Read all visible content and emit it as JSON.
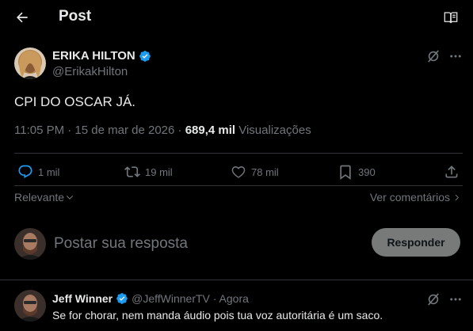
{
  "header": {
    "title": "Post"
  },
  "post": {
    "author_name": "ERIKA HILTON",
    "author_handle": "@ErikakHilton",
    "text": "CPI DO OSCAR JÁ.",
    "timestamp": "11:05 PM · 15 de mar de 2026 · ",
    "views_count": "689,4 mil",
    "views_label": " Visualizações",
    "actions": {
      "replies": "1 mil",
      "reposts": "19 mil",
      "likes": "78 mil",
      "bookmarks": "390"
    }
  },
  "sort": {
    "label": "Relevante",
    "comments_link": "Ver comentários"
  },
  "reply_box": {
    "placeholder": "Postar sua resposta",
    "button_label": "Responder"
  },
  "comment": {
    "author_name": "Jeff Winner",
    "handle_time": "@JeffWinnerTV · Agora",
    "text": "Se for chorar, nem manda áudio pois tua voz autoritária é um saco."
  },
  "colors": {
    "background": "#000000",
    "primary_text": "#e7e9ea",
    "secondary_text": "#71767b",
    "verified_blue": "#1d9bf0",
    "reply_accent": "#1d9bf0",
    "button_bg": "#787a7a"
  },
  "icons": {
    "back": "arrow-left-icon",
    "reader": "open-book-icon",
    "grok": "grok-icon",
    "more": "ellipsis-icon",
    "reply": "speech-bubble-icon",
    "repost": "repost-arrows-icon",
    "like": "heart-icon",
    "bookmark": "bookmark-icon",
    "share": "share-upload-icon"
  }
}
